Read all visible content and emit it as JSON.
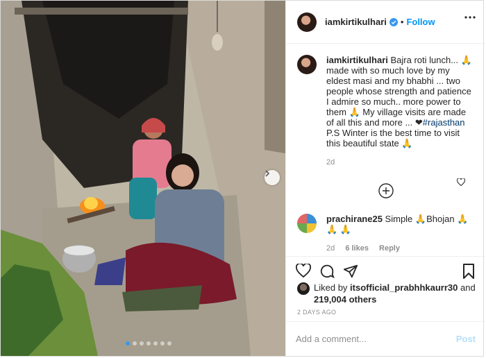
{
  "post": {
    "username": "iamkirtikulhari",
    "separator": "•",
    "follow_label": "Follow",
    "caption": {
      "username": "iamkirtikulhari",
      "text": " Bajra roti lunch... 🙏 made with so much love by my eldest masi and my bhabhi ... two people whose strength and patience I admire so much.. more power to them 🙏 My village visits are made of all this and more ... ❤",
      "hashtag": "#rajasthan",
      "text2": "P.S Winter is the best time to visit this beautiful state 🙏",
      "time": "2d"
    },
    "comment": {
      "username": "prachirane25",
      "text": " Simple 🙏Bhojan 🙏🙏 🙏",
      "time": "2d",
      "likes": "6 likes",
      "reply_label": "Reply"
    },
    "liked_by_prefix": "Liked by ",
    "liked_by_user": "itsofficial_prabhhkaurr30",
    "liked_by_and": " and",
    "liked_by_count": "219,004 others",
    "time_ago": "2 DAYS AGO",
    "add_comment_placeholder": "Add a comment...",
    "post_button": "Post"
  },
  "colors": {
    "accent": "#0095f6",
    "muted": "#8e8e8e",
    "post_disabled": "#b2dffc"
  },
  "icons": [
    "verified-icon",
    "more-icon",
    "add-icon",
    "heart-icon",
    "comment-icon",
    "share-icon",
    "bookmark-icon",
    "chevron-right-icon"
  ]
}
